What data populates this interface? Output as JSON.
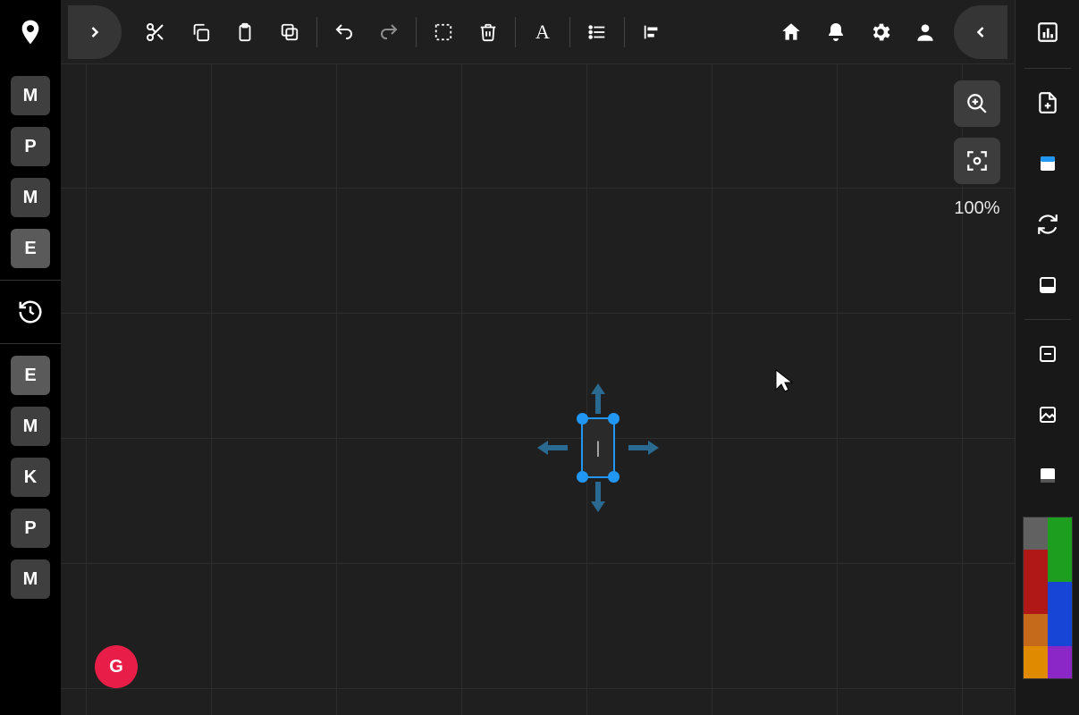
{
  "left_sidebar": {
    "tiles": [
      {
        "label": "M"
      },
      {
        "label": "P"
      },
      {
        "label": "M"
      },
      {
        "label": "E",
        "selected": true
      }
    ],
    "tiles_lower": [
      {
        "label": "E",
        "selected": true
      },
      {
        "label": "M"
      },
      {
        "label": "K"
      },
      {
        "label": "P"
      },
      {
        "label": "M"
      }
    ]
  },
  "toolbar": {
    "cut": "cut",
    "copy": "copy",
    "paste": "paste",
    "duplicate": "duplicate",
    "undo": "undo",
    "redo": "redo",
    "select_all": "select-all",
    "delete": "delete",
    "text": "text",
    "list": "list",
    "align": "align-left",
    "home": "home",
    "notifications": "notifications",
    "settings": "settings",
    "account": "account"
  },
  "canvas": {
    "selected_text": "|"
  },
  "zoom": {
    "level": "100%"
  },
  "fab": {
    "label": "G"
  },
  "right_sidebar": {
    "items": [
      "stats",
      "add-page",
      "panel",
      "sync",
      "panel-2",
      "minus",
      "image",
      "footer"
    ],
    "palette": [
      "#616161",
      "#1e9e1e",
      "#b01818",
      "#1e9e1e",
      "#b01818",
      "#1746d6",
      "#c56a1a",
      "#1746d6",
      "#e08a00",
      "#8b27c7"
    ]
  }
}
